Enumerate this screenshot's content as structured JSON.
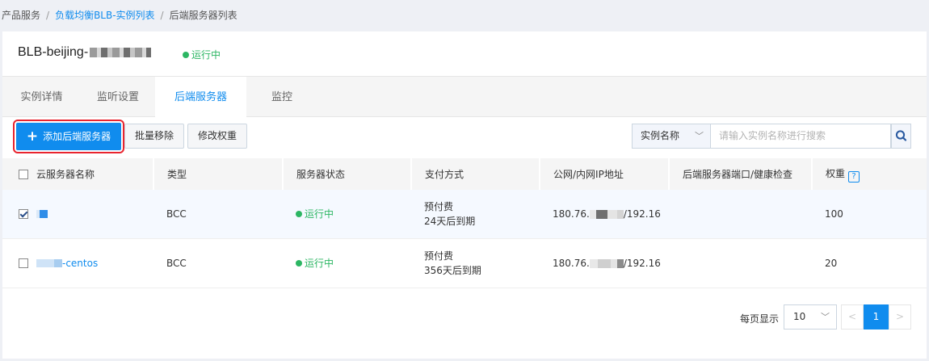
{
  "breadcrumb": {
    "items": [
      "产品服务",
      "负载均衡BLB-实例列表",
      "后端服务器列表"
    ],
    "separator": "/"
  },
  "instance": {
    "name": "BLB-beijing-",
    "status": "运行中"
  },
  "tabs": [
    {
      "label": "实例详情",
      "active": false
    },
    {
      "label": "监听设置",
      "active": false
    },
    {
      "label": "后端服务器",
      "active": true
    },
    {
      "label": "监控",
      "active": false
    }
  ],
  "toolbar": {
    "add_label": "添加后端服务器",
    "batch_remove_label": "批量移除",
    "edit_weight_label": "修改权重",
    "search_field": "实例名称",
    "search_placeholder": "请输入实例名称进行搜索"
  },
  "table": {
    "columns": [
      "云服务器名称",
      "类型",
      "服务器状态",
      "支付方式",
      "公网/内网IP地址",
      "后端服务器端口/健康检查",
      "权重"
    ],
    "rows": [
      {
        "checked": true,
        "name": "",
        "type": "BCC",
        "status": "运行中",
        "pay": "预付费",
        "expire": "24天后到期",
        "ip_public_prefix": "180.76.",
        "ip_private": "/192.16",
        "port": "",
        "weight": "100"
      },
      {
        "checked": false,
        "name": "-centos",
        "type": "BCC",
        "status": "运行中",
        "pay": "预付费",
        "expire": "356天后到期",
        "ip_public_prefix": "180.76.",
        "ip_private": "/192.16",
        "port": "",
        "weight": "20"
      }
    ]
  },
  "pagination": {
    "page_size_label": "每页显示",
    "page_size": "10",
    "current_page": "1",
    "prev_glyph": "<",
    "next_glyph": ">"
  },
  "colors": {
    "accent": "#108cee",
    "status_green": "#2cb663",
    "highlight_border": "#e8242f"
  }
}
